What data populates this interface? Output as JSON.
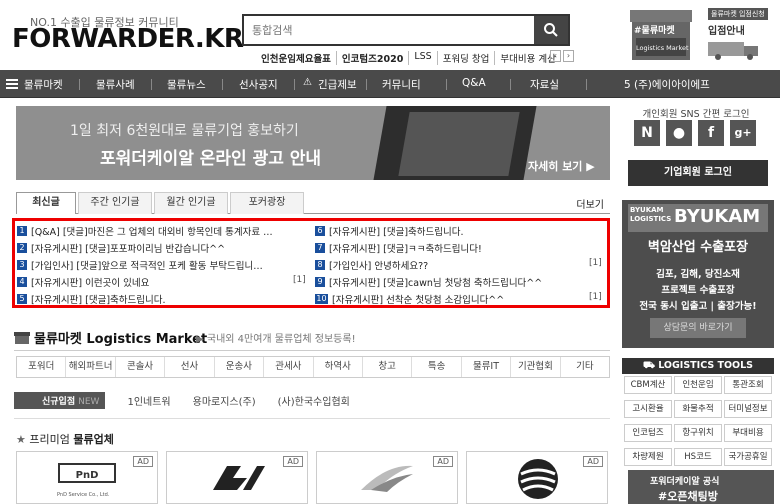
{
  "header": {
    "tagline": "NO.1 수출입 물류정보 커뮤니티",
    "logo": "FORWARDER.KR",
    "search_placeholder": "통합검색",
    "hot_keywords": [
      "인천운임제요율표",
      "인코텀즈2020",
      "LSS",
      "포워딩 창업",
      "부대비용 계산"
    ],
    "market_badge": "#물류마켓",
    "market_badge_sub": "Logistics Market",
    "entry_small": "물류마켓 입점신청",
    "entry_label": "입점안내"
  },
  "nav": {
    "items": [
      "물류마켓",
      "물류사례",
      "물류뉴스",
      "선사공지",
      "긴급제보",
      "커뮤니티",
      "Q&A",
      "자료실"
    ],
    "right_text": "5  (주)에이아이에프"
  },
  "banner": {
    "line1": "1일 최저 6천원대로 물류기업 홍보하기",
    "line2": "포워더케이알 온라인 광고 안내",
    "more": "자세히 보기 ▶"
  },
  "tabs": {
    "items": [
      "최신글",
      "주간 인기글",
      "월간 인기글",
      "포커광장"
    ],
    "more": "더보기"
  },
  "posts": {
    "left": [
      {
        "n": "1",
        "text": "[Q&A] [댓글]마진은 그 업체의 대외비 항목인데 통계자료 …",
        "count": ""
      },
      {
        "n": "2",
        "text": "[자유게시판] [댓글]포포파이리님 반갑습니다^^",
        "count": ""
      },
      {
        "n": "3",
        "text": "[가입인사] [댓글]앞으로 적극적인 포케 활동 부탁드립니…",
        "count": ""
      },
      {
        "n": "4",
        "text": "[자유게시판] 이런곳이 있네요",
        "count": "[1]"
      },
      {
        "n": "5",
        "text": "[자유게시판] [댓글]축하드립니다.",
        "count": ""
      }
    ],
    "right": [
      {
        "n": "6",
        "text": "[자유게시판] [댓글]축하드립니다.",
        "count": ""
      },
      {
        "n": "7",
        "text": "[자유게시판] [댓글]ㅋㅋ축하드립니다!",
        "count": ""
      },
      {
        "n": "8",
        "text": "[가입인사] 안녕하세요??",
        "count": "[1]"
      },
      {
        "n": "9",
        "text": "[자유게시판] [댓글]cawn님 첫당첨 축하드립니다^^",
        "count": ""
      },
      {
        "n": "10",
        "text": "[자유게시판] 선착순 첫당첨 소감입니다^^",
        "count": "[1]"
      }
    ]
  },
  "market": {
    "title": "물류마켓 Logistics Market",
    "subtitle": "▶ 국내외 4만여개 물류업체 정보등록!",
    "categories": [
      "포워더",
      "해외파트너",
      "콘솔사",
      "선사",
      "운송사",
      "관세사",
      "하역사",
      "창고",
      "특송",
      "물류IT",
      "기관협회",
      "기타"
    ],
    "new_label": "신규입점",
    "new_tag": "NEW",
    "new_items": [
      "1인네트워",
      "용마로지스(주)",
      "(사)한국수입협회"
    ],
    "premium_prefix": "프리미엄",
    "premium_bold": "물류업체",
    "ad_label": "AD",
    "card_logo_1": "PnD Service Co., Ltd."
  },
  "sidebar": {
    "sns_title": "개인회원 SNS 간편 로그인",
    "sns_buttons": [
      "N",
      "●",
      "f",
      "g+"
    ],
    "corp_login": "기업회원 로그인",
    "byukam_logo_small": "BYUKAM LOGISTICS",
    "byukam_logo": "BYUKAM",
    "byukam_title": "벽암산업 수출포장",
    "byukam_line1": "김포, 김해, 당진소재",
    "byukam_line2": "프로젝트 수출포장",
    "byukam_line3": "전국 동시 입출고 | 출장가능!",
    "byukam_consult": "상담문의 바로가기",
    "tools_title": "LOGISTICS TOOLS",
    "tools": [
      "CBM계산",
      "인천운임",
      "통관조회",
      "고시환율",
      "화물추적",
      "터미널정보",
      "인코텀즈",
      "항구위치",
      "부대비용",
      "차량제원",
      "HS코드",
      "국가공휴일"
    ],
    "promo_line1": "포워더케이알 공식",
    "promo_line2": "#오픈채팅방"
  }
}
